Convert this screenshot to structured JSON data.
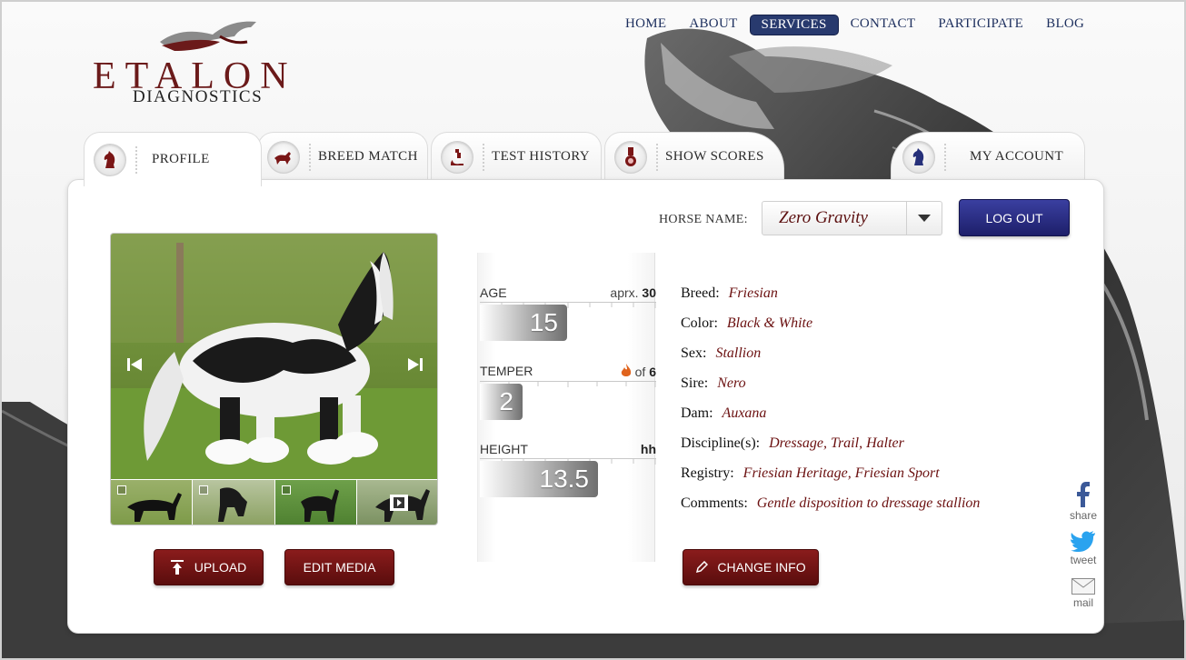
{
  "brand": {
    "name": "ETALON",
    "sub": "DIAGNOSTICS"
  },
  "topnav": {
    "items": [
      {
        "label": "HOME"
      },
      {
        "label": "ABOUT"
      },
      {
        "label": "SERVICES",
        "active": true
      },
      {
        "label": "CONTACT"
      },
      {
        "label": "PARTICIPATE"
      },
      {
        "label": "BLOG"
      }
    ]
  },
  "tabs": [
    {
      "label": "PROFILE",
      "icon": "knight-red-icon",
      "active": true
    },
    {
      "label": "BREED MATCH",
      "icon": "horse-running-icon"
    },
    {
      "label": "TEST HISTORY",
      "icon": "microscope-icon"
    },
    {
      "label": "SHOW SCORES",
      "icon": "medal-icon"
    },
    {
      "label": "MY ACCOUNT",
      "icon": "knight-blue-icon"
    }
  ],
  "horse": {
    "label": "HORSE NAME:",
    "selected": "Zero Gravity"
  },
  "logout_label": "LOG OUT",
  "gallery": {
    "thumbnail_count": 4
  },
  "buttons": {
    "upload": "UPLOAD",
    "edit_media": "EDIT MEDIA",
    "change_info": "CHANGE INFO"
  },
  "stats": {
    "age": {
      "label": "AGE",
      "right_prefix": "aprx.",
      "right_value": "30",
      "value": "15"
    },
    "temper": {
      "label": "TEMPER",
      "right_prefix": "of",
      "right_value": "6",
      "value": "2"
    },
    "height": {
      "label": "HEIGHT",
      "right_value": "hh",
      "value": "13.5"
    }
  },
  "info": [
    {
      "key": "Breed:",
      "value": "Friesian"
    },
    {
      "key": "Color:",
      "value": "Black & White"
    },
    {
      "key": "Sex:",
      "value": "Stallion"
    },
    {
      "key": "Sire:",
      "value": "Nero"
    },
    {
      "key": "Dam:",
      "value": "Auxana"
    },
    {
      "key": "Discipline(s):",
      "value": "Dressage, Trail, Halter"
    },
    {
      "key": "Registry:",
      "value": "Friesian Heritage, Friesian Sport"
    },
    {
      "key": "Comments:",
      "value": "Gentle disposition to dressage stallion"
    }
  ],
  "social": {
    "share": "share",
    "tweet": "tweet",
    "mail": "mail"
  },
  "colors": {
    "brand_red": "#6b1a1a",
    "nav_blue": "#283a6e",
    "button_red": "#7a1616",
    "logout_blue": "#2a2e86"
  }
}
